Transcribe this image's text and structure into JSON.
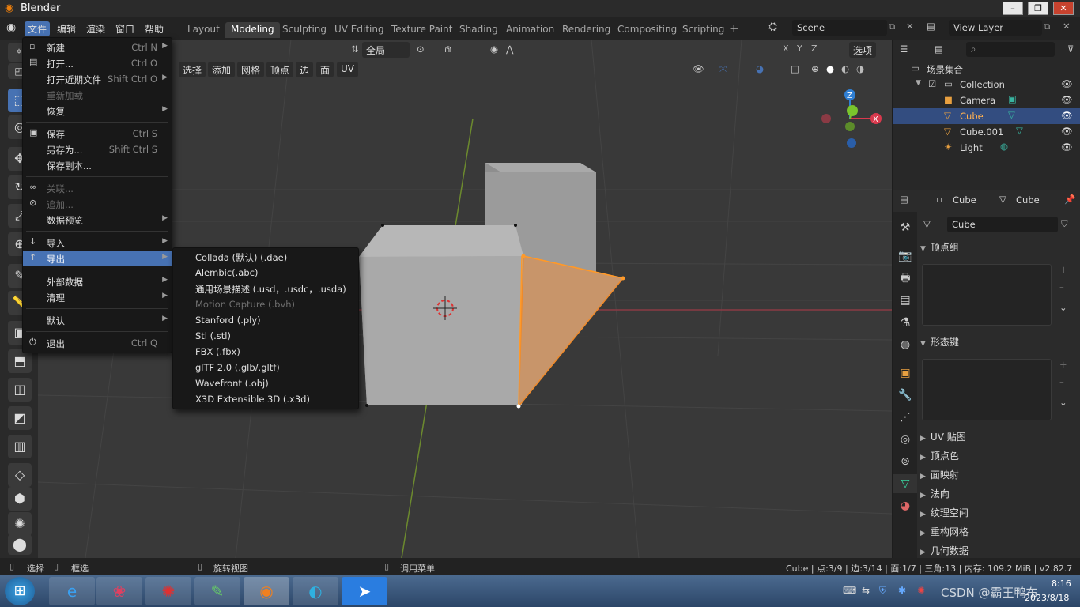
{
  "window": {
    "title": "Blender"
  },
  "menubar": {
    "items": [
      "文件",
      "编辑",
      "渲染",
      "窗口",
      "帮助"
    ]
  },
  "workspace_tabs": [
    "Layout",
    "Modeling",
    "Sculpting",
    "UV Editing",
    "Texture Paint",
    "Shading",
    "Animation",
    "Rendering",
    "Compositing",
    "Scripting"
  ],
  "active_tab": "Modeling",
  "scene": {
    "label": "Scene",
    "view_layer": "View Layer"
  },
  "viewport_header": {
    "transform": "全局",
    "options": "选项",
    "axes": [
      "X",
      "Y",
      "Z"
    ],
    "edit_menus": [
      "选择",
      "添加",
      "网格",
      "顶点",
      "边",
      "面",
      "UV"
    ]
  },
  "file_menu": [
    {
      "label": "新建",
      "shortcut": "Ctrl N",
      "arrow": true,
      "disabled": false,
      "icon": "new-file-icon",
      "glyph": "▫"
    },
    {
      "label": "打开...",
      "shortcut": "Ctrl O",
      "arrow": false,
      "disabled": false,
      "icon": "open-folder-icon",
      "glyph": "▤"
    },
    {
      "label": "打开近期文件",
      "shortcut": "Shift Ctrl O",
      "arrow": true,
      "disabled": false,
      "icon": "",
      "glyph": ""
    },
    {
      "label": "重新加载",
      "shortcut": "",
      "arrow": false,
      "disabled": true,
      "icon": "",
      "glyph": ""
    },
    {
      "label": "恢复",
      "shortcut": "",
      "arrow": true,
      "disabled": false,
      "icon": "",
      "glyph": ""
    },
    {
      "sep": true
    },
    {
      "label": "保存",
      "shortcut": "Ctrl S",
      "arrow": false,
      "disabled": false,
      "icon": "save-icon",
      "glyph": "▣"
    },
    {
      "label": "另存为...",
      "shortcut": "Shift Ctrl S",
      "arrow": false,
      "disabled": false,
      "icon": "",
      "glyph": ""
    },
    {
      "label": "保存副本...",
      "shortcut": "",
      "arrow": false,
      "disabled": false,
      "icon": "",
      "glyph": ""
    },
    {
      "sep": true
    },
    {
      "label": "关联...",
      "shortcut": "",
      "arrow": false,
      "disabled": true,
      "icon": "link-icon",
      "glyph": "∞"
    },
    {
      "label": "追加...",
      "shortcut": "",
      "arrow": false,
      "disabled": true,
      "icon": "append-icon",
      "glyph": "⊘"
    },
    {
      "label": "数据预览",
      "shortcut": "",
      "arrow": true,
      "disabled": false,
      "icon": "",
      "glyph": ""
    },
    {
      "sep": true
    },
    {
      "label": "导入",
      "shortcut": "",
      "arrow": true,
      "disabled": false,
      "icon": "import-icon",
      "glyph": "↓"
    },
    {
      "label": "导出",
      "shortcut": "",
      "arrow": true,
      "disabled": false,
      "icon": "export-icon",
      "glyph": "↑",
      "highlighted": true
    },
    {
      "sep": true
    },
    {
      "label": "外部数据",
      "shortcut": "",
      "arrow": true,
      "disabled": false,
      "icon": "",
      "glyph": ""
    },
    {
      "label": "清理",
      "shortcut": "",
      "arrow": true,
      "disabled": false,
      "icon": "",
      "glyph": ""
    },
    {
      "sep": true
    },
    {
      "label": "默认",
      "shortcut": "",
      "arrow": true,
      "disabled": false,
      "icon": "",
      "glyph": ""
    },
    {
      "sep": true
    },
    {
      "label": "退出",
      "shortcut": "Ctrl Q",
      "arrow": false,
      "disabled": false,
      "icon": "quit-icon",
      "glyph": "⏻"
    }
  ],
  "export_submenu": [
    {
      "label": "Collada (默认) (.dae)",
      "disabled": false
    },
    {
      "label": "Alembic(.abc)",
      "disabled": false
    },
    {
      "label": "通用场景描述 (.usd，.usdc，.usda)",
      "disabled": false
    },
    {
      "label": "Motion Capture (.bvh)",
      "disabled": true
    },
    {
      "label": "Stanford (.ply)",
      "disabled": false
    },
    {
      "label": "Stl (.stl)",
      "disabled": false
    },
    {
      "label": "FBX (.fbx)",
      "disabled": false
    },
    {
      "label": "glTF 2.0 (.glb/.gltf)",
      "disabled": false
    },
    {
      "label": "Wavefront (.obj)",
      "disabled": false
    },
    {
      "label": "X3D Extensible 3D (.x3d)",
      "disabled": false
    }
  ],
  "outliner": {
    "root": "场景集合",
    "collection": "Collection",
    "items": [
      {
        "name": "Camera",
        "selected": false,
        "color": "#e8a040"
      },
      {
        "name": "Cube",
        "selected": true,
        "color": "#e8a040"
      },
      {
        "name": "Cube.001",
        "selected": false,
        "color": "#e8a040"
      },
      {
        "name": "Light",
        "selected": false,
        "color": "#e8a040"
      }
    ]
  },
  "properties": {
    "object": "Cube",
    "mesh": "Cube",
    "datablock": "Cube",
    "sections_open": [
      "顶点组",
      "形态键"
    ],
    "sections_closed": [
      "UV 贴图",
      "顶点色",
      "面映射",
      "法向",
      "纹理空间",
      "重构网格",
      "几何数据"
    ]
  },
  "statusbar": {
    "left": [
      "选择",
      "框选",
      "旋转视图",
      "调用菜单"
    ],
    "right": "Cube | 点:3/9 | 边:3/14 | 面:1/7 | 三角:13 | 内存: 109.2 MiB | v2.82.7"
  },
  "taskbar": {
    "time": "8:16",
    "date": "2023/8/18",
    "watermark": "CSDN @霸王鸭布"
  },
  "colors": {
    "accent": "#4772b3",
    "selected_face": "#c8956a",
    "axis_x": "#d9394d",
    "axis_y": "#7ac42c",
    "axis_z": "#2f7fd4"
  }
}
